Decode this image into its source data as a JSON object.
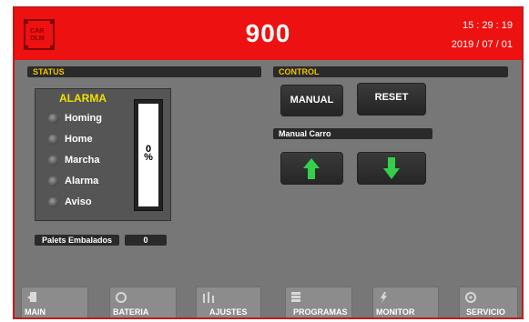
{
  "header": {
    "title": "900",
    "time": "15 : 29 : 19",
    "date": "2019 / 07 / 01",
    "logo_text": "CAR OLM"
  },
  "status": {
    "section_label": "STATUS",
    "alarm_title": "ALARMA",
    "indicators": [
      {
        "label": "Homing"
      },
      {
        "label": "Home"
      },
      {
        "label": "Marcha"
      },
      {
        "label": "Alarma"
      },
      {
        "label": "Aviso"
      }
    ],
    "gauge_value": 0,
    "gauge_number": "0",
    "gauge_unit": "%"
  },
  "palets": {
    "label": "Palets Embalados",
    "value": "0"
  },
  "control": {
    "section_label": "CONTROL",
    "manual_label": "MANUAL",
    "reset_label": "RESET",
    "manual_carro_label": "Manual Carro"
  },
  "nav": [
    {
      "label": "MAIN",
      "icon": "door-exit-icon"
    },
    {
      "label": "BATERIA",
      "icon": "battery-icon"
    },
    {
      "label": "AJUSTES",
      "icon": "sliders-icon"
    },
    {
      "label": "PROGRAMAS",
      "icon": "list-icon"
    },
    {
      "label": "MONITOR",
      "icon": "bolt-icon"
    },
    {
      "label": "SERVICIO",
      "icon": "wrench-icon"
    }
  ],
  "colors": {
    "header_bg": "#ee1111",
    "panel_bg": "#777777",
    "section_text": "#f0c400",
    "alarm_title": "#f0e000",
    "arrow_green": "#33d14a"
  }
}
